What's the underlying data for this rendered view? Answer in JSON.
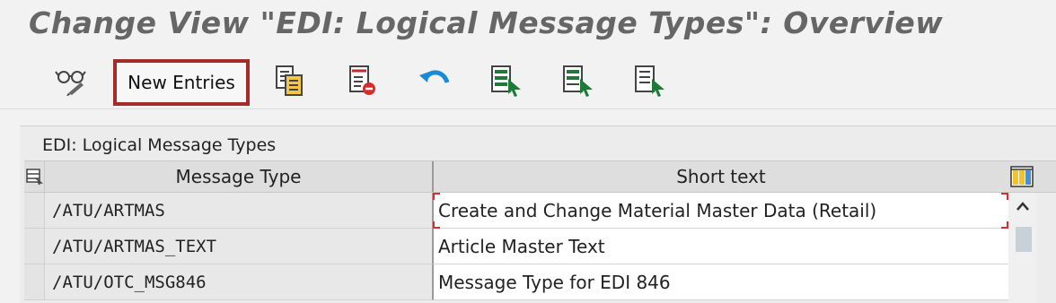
{
  "window": {
    "title": "Change View \"EDI: Logical Message Types\": Overview"
  },
  "toolbar": {
    "buttons": [
      {
        "icon": "display-change-glasses-icon"
      },
      {
        "label": "New Entries"
      },
      {
        "icon": "copy-as-icon"
      },
      {
        "icon": "delete-icon"
      },
      {
        "icon": "undo-change-icon"
      },
      {
        "icon": "select-all-icon"
      },
      {
        "icon": "select-block-icon"
      },
      {
        "icon": "deselect-all-icon"
      }
    ]
  },
  "table": {
    "title": "EDI: Logical Message Types",
    "columns": [
      "Message Type",
      "Short text"
    ],
    "rows": [
      {
        "message_type": "/ATU/ARTMAS",
        "short_text": "Create and Change Material Master Data (Retail)"
      },
      {
        "message_type": "/ATU/ARTMAS_TEXT",
        "short_text": "Article Master Text"
      },
      {
        "message_type": "/ATU/OTC_MSG846",
        "short_text": "Message Type for EDI 846"
      }
    ]
  },
  "colors": {
    "highlight_border": "#a52a2a",
    "focus_marker": "#d03030",
    "select_green": "#1f7a3a",
    "undo_blue": "#1a8ad4"
  }
}
